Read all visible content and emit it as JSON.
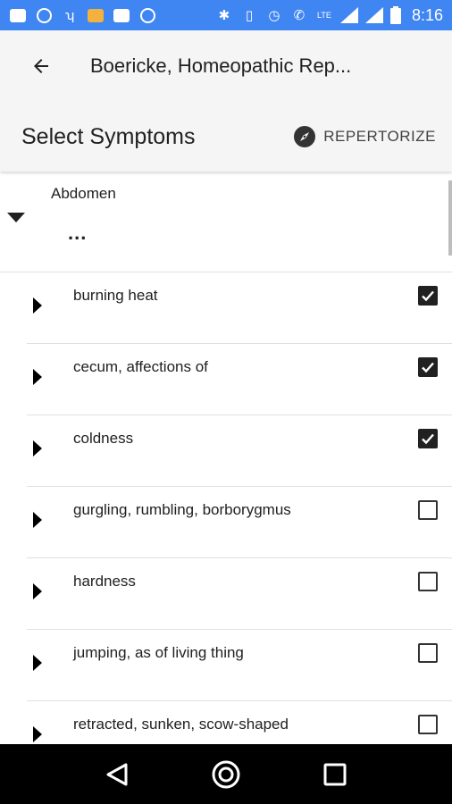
{
  "status_bar": {
    "time": "8:16",
    "icons": [
      "message-icon",
      "chrome-icon",
      "app-icon",
      "photo-icon",
      "gallery-icon",
      "whatsapp-icon",
      "bluetooth-icon",
      "vibrate-icon",
      "alarm-icon",
      "call-4g-icon",
      "lte-icon",
      "signal-icon",
      "signal-icon",
      "battery-icon"
    ]
  },
  "toolbar": {
    "title": "Boericke, Homeopathic Rep..."
  },
  "subheader": {
    "title": "Select Symptoms",
    "repertorize_label": "REPERTORIZE"
  },
  "parent": {
    "name": "Abdomen",
    "more": "..."
  },
  "symptoms": [
    {
      "label": "burning heat",
      "checked": true
    },
    {
      "label": "cecum, affections of",
      "checked": true
    },
    {
      "label": "coldness",
      "checked": true
    },
    {
      "label": "gurgling, rumbling, borborygmus",
      "checked": false
    },
    {
      "label": "hardness",
      "checked": false
    },
    {
      "label": "jumping, as of living thing",
      "checked": false
    },
    {
      "label": "retracted, sunken, scow-shaped",
      "checked": false
    }
  ],
  "colors": {
    "status_bar": "#3f86f2",
    "toolbar": "#f5f5f5",
    "checkbox_checked": "#212121"
  }
}
